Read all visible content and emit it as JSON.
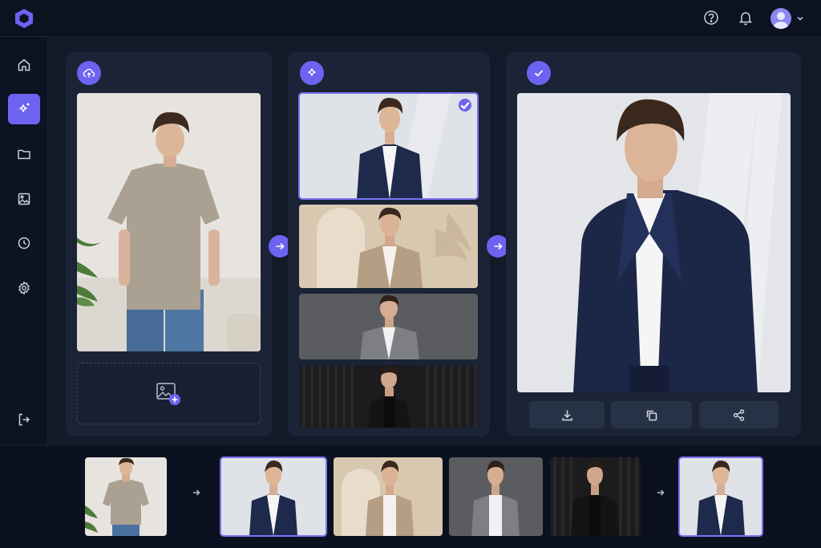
{
  "app": {
    "logo_icon": "hexagon-logo-icon",
    "accent": "#6c63f0"
  },
  "header": {
    "icons": [
      "help-icon",
      "bell-icon",
      "avatar",
      "chevron-down-icon"
    ]
  },
  "sidebar": {
    "items": [
      {
        "name": "home",
        "icon": "home-icon",
        "active": false
      },
      {
        "name": "ai-generate",
        "icon": "sparkle-icon",
        "active": true
      },
      {
        "name": "files",
        "icon": "folder-icon",
        "active": false
      },
      {
        "name": "gallery",
        "icon": "image-icon",
        "active": false
      },
      {
        "name": "history",
        "icon": "clock-icon",
        "active": false
      },
      {
        "name": "settings",
        "icon": "gear-icon",
        "active": false
      },
      {
        "name": "logout",
        "icon": "logout-icon",
        "active": false
      }
    ]
  },
  "workflow": {
    "steps": [
      {
        "name": "upload",
        "icon": "upload-cloud-icon"
      },
      {
        "name": "generate",
        "icon": "sparkle-icon"
      },
      {
        "name": "result",
        "icon": "check-icon"
      }
    ],
    "variations": [
      {
        "style": "navy suit, light studio",
        "selected": true
      },
      {
        "style": "beige suit, arch backdrop",
        "selected": false
      },
      {
        "style": "gray suit, dark gray backdrop",
        "selected": false
      },
      {
        "style": "black suit, black backdrop",
        "selected": false
      }
    ],
    "actions": [
      "download-icon",
      "copy-icon",
      "share-icon"
    ],
    "add_image_icon": "add-image-icon"
  },
  "strip": {
    "thumbs": [
      "original",
      "navy",
      "beige",
      "gray",
      "black",
      "result"
    ]
  }
}
